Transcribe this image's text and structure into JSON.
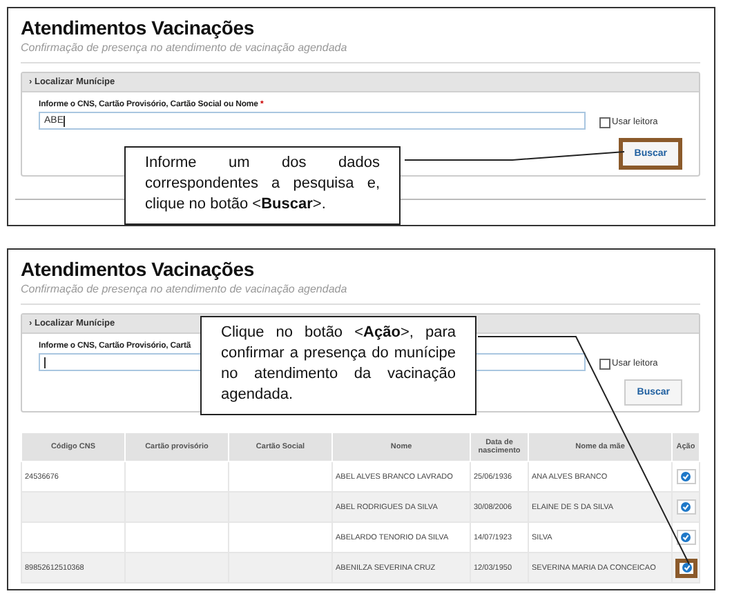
{
  "screens": [
    {
      "title": "Atendimentos Vacinações",
      "subtitle": "Confirmação de presença no atendimento de vacinação agendada",
      "section": {
        "title": "› Localizar Munícipe",
        "field_label": "Informe o CNS, Cartão Provisório, Cartão Social ou Nome",
        "required_mark": "*",
        "value": "ABE",
        "reader": {
          "label": "Usar leitora",
          "checked": false
        },
        "search_button": {
          "label": "Buscar",
          "highlighted": true
        }
      },
      "callout": {
        "text": "Informe um dos dados correspondentes a pesquisa e, clique no botão <**Buscar**>."
      }
    },
    {
      "title": "Atendimentos Vacinações",
      "subtitle": "Confirmação de presença no atendimento de vacinação agendada",
      "section": {
        "title": "› Localizar Munícipe",
        "field_label": "Informe o CNS, Cartão Provisório, Cartã",
        "reader": {
          "label": "Usar leitora",
          "checked": false
        },
        "search_button": {
          "label": "Buscar",
          "highlighted": false
        }
      },
      "table": {
        "columns": [
          "Código CNS",
          "Cartão provisório",
          "Cartão Social",
          "Nome",
          "Data de nascimento",
          "Nome da mãe",
          "Ação"
        ],
        "rows": [
          {
            "cells": [
              "24536676",
              "",
              "",
              "ABEL ALVES BRANCO LAVRADO",
              "25/06/1936",
              "ANA ALVES BRANCO"
            ],
            "action_highlighted": false
          },
          {
            "cells": [
              "",
              "",
              "",
              "ABEL RODRIGUES DA SILVA",
              "30/08/2006",
              "ELAINE DE S DA SILVA"
            ],
            "action_highlighted": false
          },
          {
            "cells": [
              "",
              "",
              "",
              "ABELARDO TENORIO DA SILVA",
              "14/07/1923",
              "SILVA"
            ],
            "action_highlighted": false
          },
          {
            "cells": [
              "89852612510368",
              "",
              "",
              "ABENILZA SEVERINA CRUZ",
              "12/03/1950",
              "SEVERINA MARIA DA CONCEICAO"
            ],
            "action_highlighted": true
          }
        ]
      },
      "callout": {
        "text": "Clique no botão <**Ação**>, para confirmar a presença do munícipe no atendimento da vacinação agendada."
      }
    }
  ]
}
